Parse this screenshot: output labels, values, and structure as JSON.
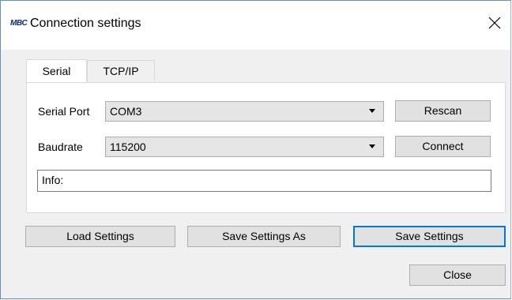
{
  "window": {
    "logo_text": "MBC",
    "title": "Connection settings"
  },
  "tabs": [
    {
      "label": "Serial",
      "active": true
    },
    {
      "label": "TCP/IP",
      "active": false
    }
  ],
  "serial": {
    "port_label": "Serial Port",
    "port_value": "COM3",
    "baud_label": "Baudrate",
    "baud_value": "115200",
    "rescan_label": "Rescan",
    "connect_label": "Connect",
    "info_text": "Info:"
  },
  "footer": {
    "load_label": "Load Settings",
    "save_as_label": "Save Settings As",
    "save_label": "Save Settings",
    "close_label": "Close"
  },
  "colors": {
    "accent": "#0078d7",
    "logo": "#0b2a78"
  }
}
